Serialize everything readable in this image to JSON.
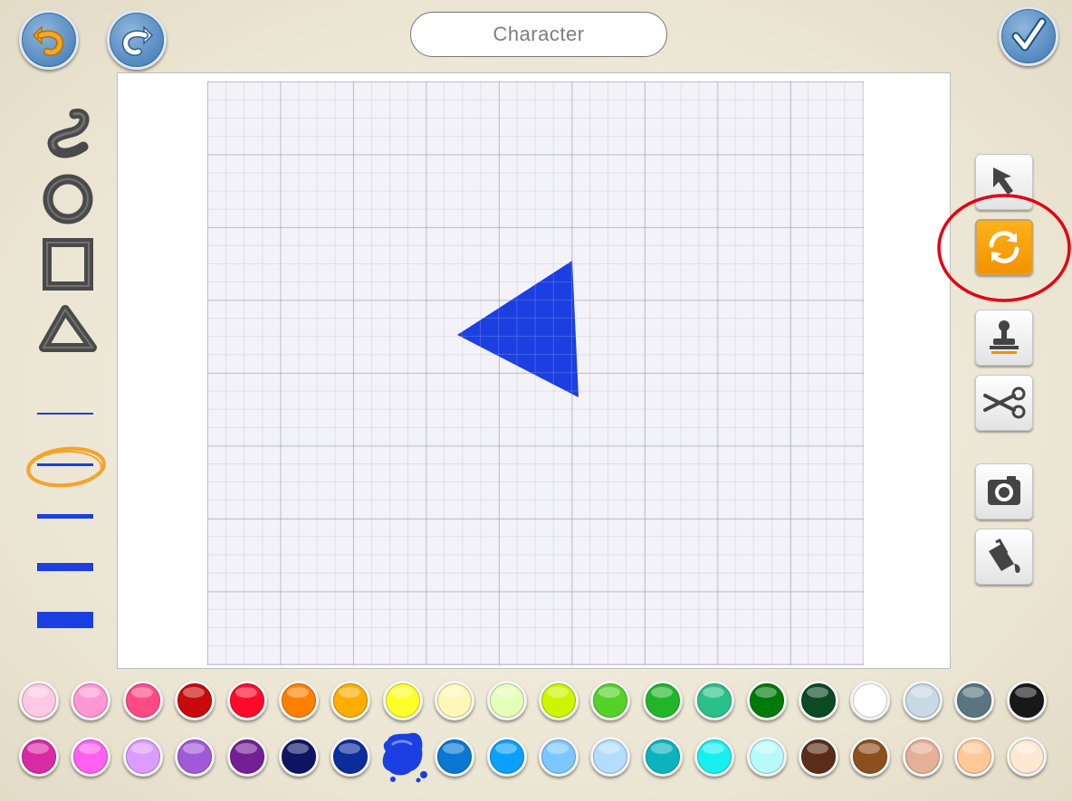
{
  "header": {
    "title": "Character",
    "undo_icon": "undo-arrow-icon",
    "redo_icon": "redo-arrow-icon",
    "done_icon": "checkmark-icon"
  },
  "left_tools": {
    "shapes": [
      "freehand-icon",
      "ellipse-icon",
      "rectangle-icon",
      "triangle-icon"
    ],
    "line_widths": [
      "thinnest",
      "thin",
      "medium",
      "thick",
      "thickest"
    ],
    "selected_line_width": "thin"
  },
  "right_tools": [
    "select-arrow-icon",
    "rotate-icon",
    "stamp-icon",
    "scissors-icon",
    "camera-icon",
    "paint-bucket-icon"
  ],
  "selected_right_tool": "rotate-icon",
  "canvas": {
    "shape": "triangle",
    "fill_color": "#1b3fe0"
  },
  "palette": {
    "row1": [
      "#ffc8e4",
      "#ff98d2",
      "#ff4a86",
      "#c80a0a",
      "#ff0a2a",
      "#ff8000",
      "#ffad00",
      "#ffff2a",
      "#fff7b8",
      "#e4ffb8",
      "#ccf500",
      "#55d22a",
      "#22b52a",
      "#2ac08a",
      "#007a0a",
      "#0c4a25",
      "#ffffff",
      "#c8d8e4",
      "#5a7580",
      "#181818"
    ],
    "row2": [
      "#d92aa5",
      "#ff60f0",
      "#dc9cff",
      "#a05ad8",
      "#741f96",
      "#101463",
      "#0a2d9a",
      "#1b3fe0",
      "#0a78d2",
      "#0aa0ff",
      "#7ac8ff",
      "#b4dcff",
      "#0ab4be",
      "#18f0f0",
      "#b8fafa",
      "#5a2d18",
      "#8c501e",
      "#e4b096",
      "#ffc896",
      "#ffe8d2"
    ],
    "selected": "#1b3fe0"
  }
}
